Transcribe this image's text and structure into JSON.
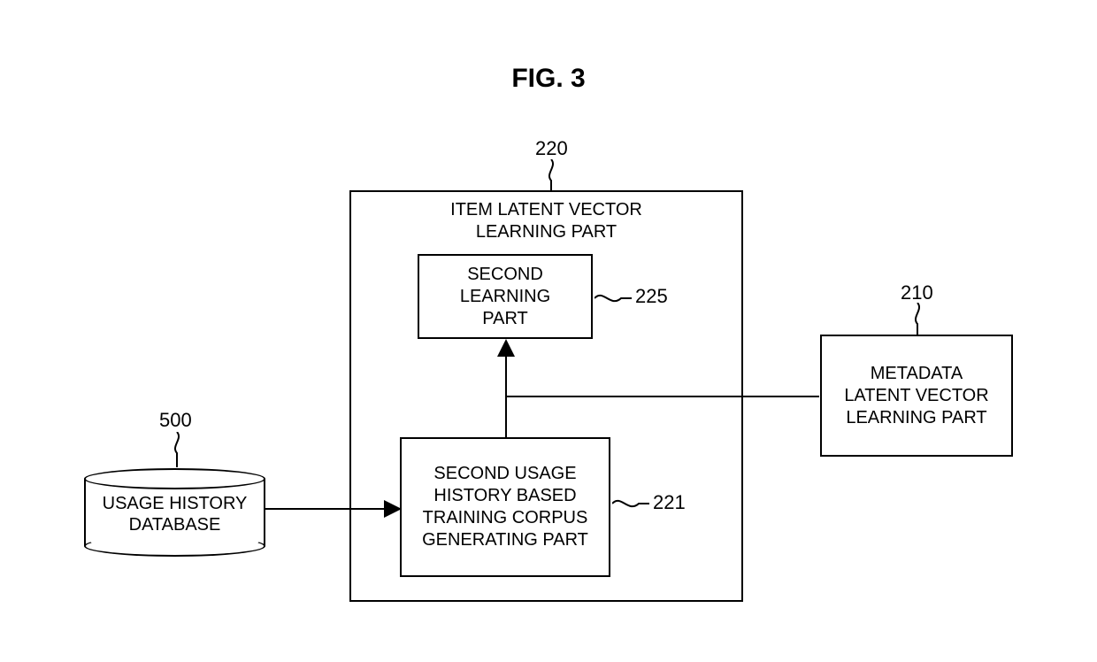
{
  "title": "FIG. 3",
  "refs": {
    "r500": "500",
    "r220": "220",
    "r225": "225",
    "r221": "221",
    "r210": "210"
  },
  "blocks": {
    "database": "USAGE HISTORY\nDATABASE",
    "item_latent": "ITEM LATENT VECTOR\nLEARNING PART",
    "second_learning": "SECOND\nLEARNING\nPART",
    "corpus": "SECOND USAGE\nHISTORY BASED\nTRAINING CORPUS\nGENERATING PART",
    "metadata": "METADATA\nLATENT VECTOR\nLEARNING PART"
  }
}
